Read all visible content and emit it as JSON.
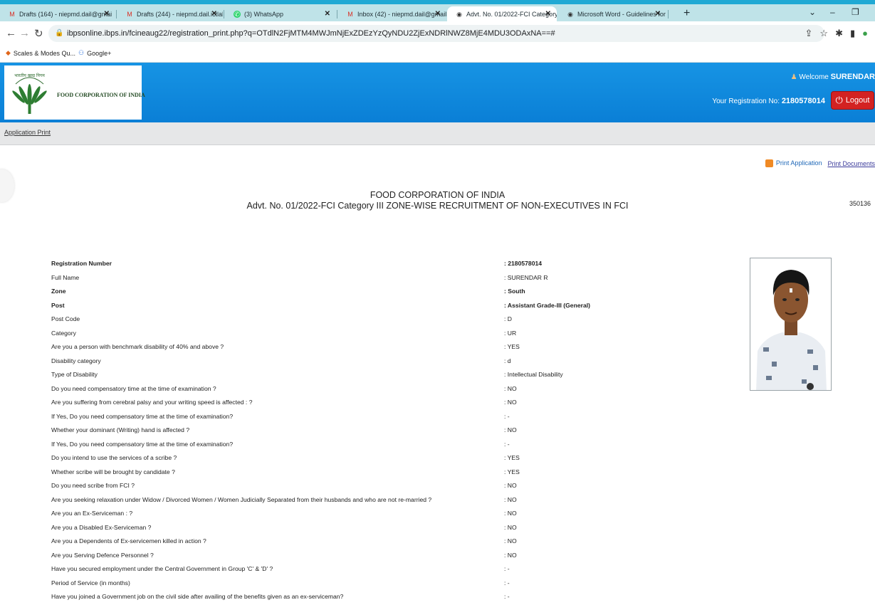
{
  "browser": {
    "tabs": [
      {
        "label": "Drafts (164) - niepmd.dail@gmai",
        "icon": "gmail-icon"
      },
      {
        "label": "Drafts (244) - niepmd.dail.ictlab@",
        "icon": "gmail-icon"
      },
      {
        "label": "(3) WhatsApp",
        "icon": "whatsapp-icon"
      },
      {
        "label": "Inbox (42) - niepmd.dail@gmail.",
        "icon": "gmail-icon"
      },
      {
        "label": "Advt. No. 01/2022-FCI Category I",
        "icon": "globe-icon"
      },
      {
        "label": "Microsoft Word - Guidelines for",
        "icon": "globe-icon"
      }
    ],
    "url": "ibpsonline.ibps.in/fcineaug22/registration_print.php?q=OTdlN2FjMTM4MWJmNjExZDEzYzQyNDU2ZjExNDRlNWZ8MjE4MDU3ODAxNA==#",
    "bookmarks": [
      "Scales & Modes Qu...",
      "Google+"
    ]
  },
  "header": {
    "org_name": "FOOD CORPORATION OF INDIA",
    "emblem_text": "भारतीय खाद्य निगम",
    "welcome_prefix": "Welcome",
    "welcome_name": "SURENDAR",
    "reg_prefix": "Your Registration No:",
    "reg_number": "2180578014",
    "logout_label": "Logout"
  },
  "subnav": {
    "link": "Application Print"
  },
  "print_links": {
    "print_application": "Print Application",
    "print_documents": "Print Documents"
  },
  "title": {
    "line1": "FOOD CORPORATION OF INDIA",
    "line2": "Advt. No. 01/2022-FCI Category III ZONE-WISE RECRUITMENT OF NON-EXECUTIVES IN FCI",
    "code": "350136"
  },
  "details": [
    {
      "label": "Registration Number",
      "value": ": 2180578014",
      "bold": true
    },
    {
      "label": "Full Name",
      "value": ": SURENDAR R",
      "bold": false
    },
    {
      "label": "Zone",
      "value": ": South",
      "bold": true
    },
    {
      "label": "Post",
      "value": ": Assistant Grade-III (General)",
      "bold": true
    },
    {
      "label": "Post Code",
      "value": ": D",
      "bold": false
    },
    {
      "label": "Category",
      "value": ": UR",
      "bold": false
    },
    {
      "label": "Are you a person with benchmark disability of 40% and above ?",
      "value": ": YES",
      "bold": false
    },
    {
      "label": "Disability category",
      "value": ": d",
      "bold": false
    },
    {
      "label": "Type of Disability",
      "value": ": Intellectual Disability",
      "bold": false
    },
    {
      "label": "Do you need compensatory time at the time of examination ?",
      "value": ": NO",
      "bold": false
    },
    {
      "label": "Are you suffering from cerebral palsy and your writing speed is affected : ?",
      "value": ": NO",
      "bold": false
    },
    {
      "label": "If Yes, Do you need compensatory time at the time of examination?",
      "value": ": -",
      "bold": false
    },
    {
      "label": "Whether your dominant (Writing) hand is affected ?",
      "value": ": NO",
      "bold": false
    },
    {
      "label": "If Yes, Do you need compensatory time at the time of examination?",
      "value": ": -",
      "bold": false
    },
    {
      "label": "Do you intend to use the services of a scribe ?",
      "value": ": YES",
      "bold": false
    },
    {
      "label": "Whether scribe will be brought by candidate ?",
      "value": ": YES",
      "bold": false
    },
    {
      "label": "Do you need scribe from FCI ?",
      "value": ": NO",
      "bold": false
    },
    {
      "label": "Are you seeking relaxation under Widow / Divorced Women / Women Judicially Separated from their husbands and who are not re-married ?",
      "value": ": NO",
      "bold": false
    },
    {
      "label": "Are you an Ex-Serviceman : ?",
      "value": ": NO",
      "bold": false
    },
    {
      "label": "Are you a Disabled Ex-Serviceman ?",
      "value": ": NO",
      "bold": false
    },
    {
      "label": "Are you a Dependents of Ex-servicemen killed in action ?",
      "value": ": NO",
      "bold": false
    },
    {
      "label": "Are you Serving Defence Personnel ?",
      "value": ": NO",
      "bold": false
    },
    {
      "label": "Have you secured employment under the Central Government in Group 'C' & 'D' ?",
      "value": ": -",
      "bold": false
    },
    {
      "label": "Period of Service (in months)",
      "value": ": -",
      "bold": false
    },
    {
      "label": "Have you joined a Government job on the civil side after availing of the benefits given as an ex-serviceman?",
      "value": ": -",
      "bold": false
    }
  ]
}
